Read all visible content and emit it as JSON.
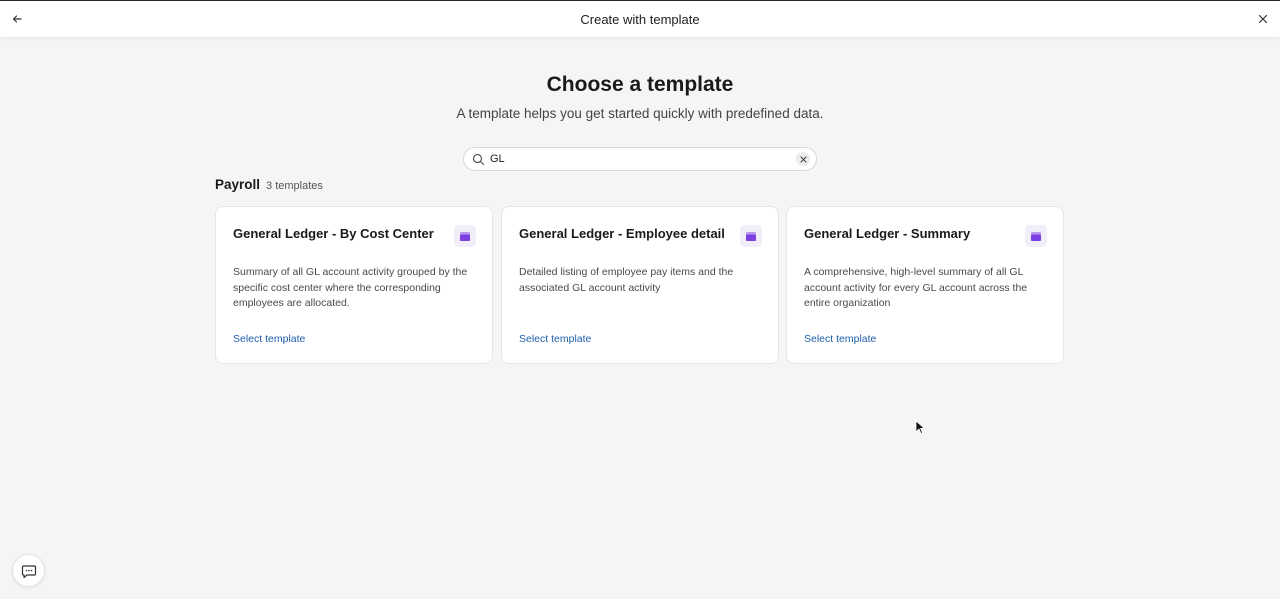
{
  "header": {
    "title": "Create with template",
    "back_icon": "arrow-left-icon",
    "close_icon": "close-icon"
  },
  "main": {
    "heading": "Choose a template",
    "subheading": "A template helps you get started quickly with predefined data."
  },
  "search": {
    "value": "GL",
    "placeholder": "",
    "icon": "search-icon",
    "clear_icon": "clear-icon"
  },
  "section": {
    "name": "Payroll",
    "count": "3 templates"
  },
  "cards": [
    {
      "title": "General Ledger - By Cost Center",
      "description": "Summary of all GL account activity grouped by the specific cost center where the corresponding employees are allocated.",
      "action": "Select template",
      "icon": "folder-icon"
    },
    {
      "title": "General Ledger - Employee detail",
      "description": "Detailed listing of employee pay items and the associated GL account activity",
      "action": "Select template",
      "icon": "folder-icon"
    },
    {
      "title": "General Ledger - Summary",
      "description": "A comprehensive, high-level summary of all GL account activity for every GL account across the entire organization",
      "action": "Select template",
      "icon": "folder-icon"
    }
  ],
  "chat": {
    "icon": "chat-icon"
  },
  "colors": {
    "link": "#1f5fae",
    "icon_accent": "#7b3fe4",
    "icon_bg": "#f1eef9",
    "page_bg": "#f5f5f5"
  }
}
